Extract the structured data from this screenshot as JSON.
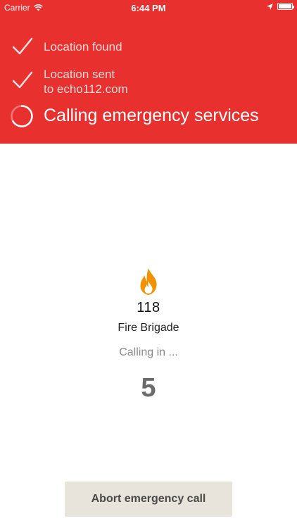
{
  "status_bar": {
    "carrier": "Carrier",
    "time": "6:44 PM"
  },
  "steps": [
    {
      "label_line1": "Location found",
      "label_line2": "",
      "state": "done"
    },
    {
      "label_line1": "Location sent",
      "label_line2": "to echo112.com",
      "state": "done"
    },
    {
      "label_line1": "Calling emergency services",
      "label_line2": "",
      "state": "in-progress"
    }
  ],
  "service": {
    "icon": "fire-icon",
    "number": "118",
    "name": "Fire Brigade"
  },
  "countdown": {
    "label": "Calling in ...",
    "value": "5"
  },
  "abort_label": "Abort emergency call",
  "colors": {
    "header_red": "#e8302e",
    "button_bg": "#e8e4dc",
    "flame_orange": "#f39200"
  }
}
